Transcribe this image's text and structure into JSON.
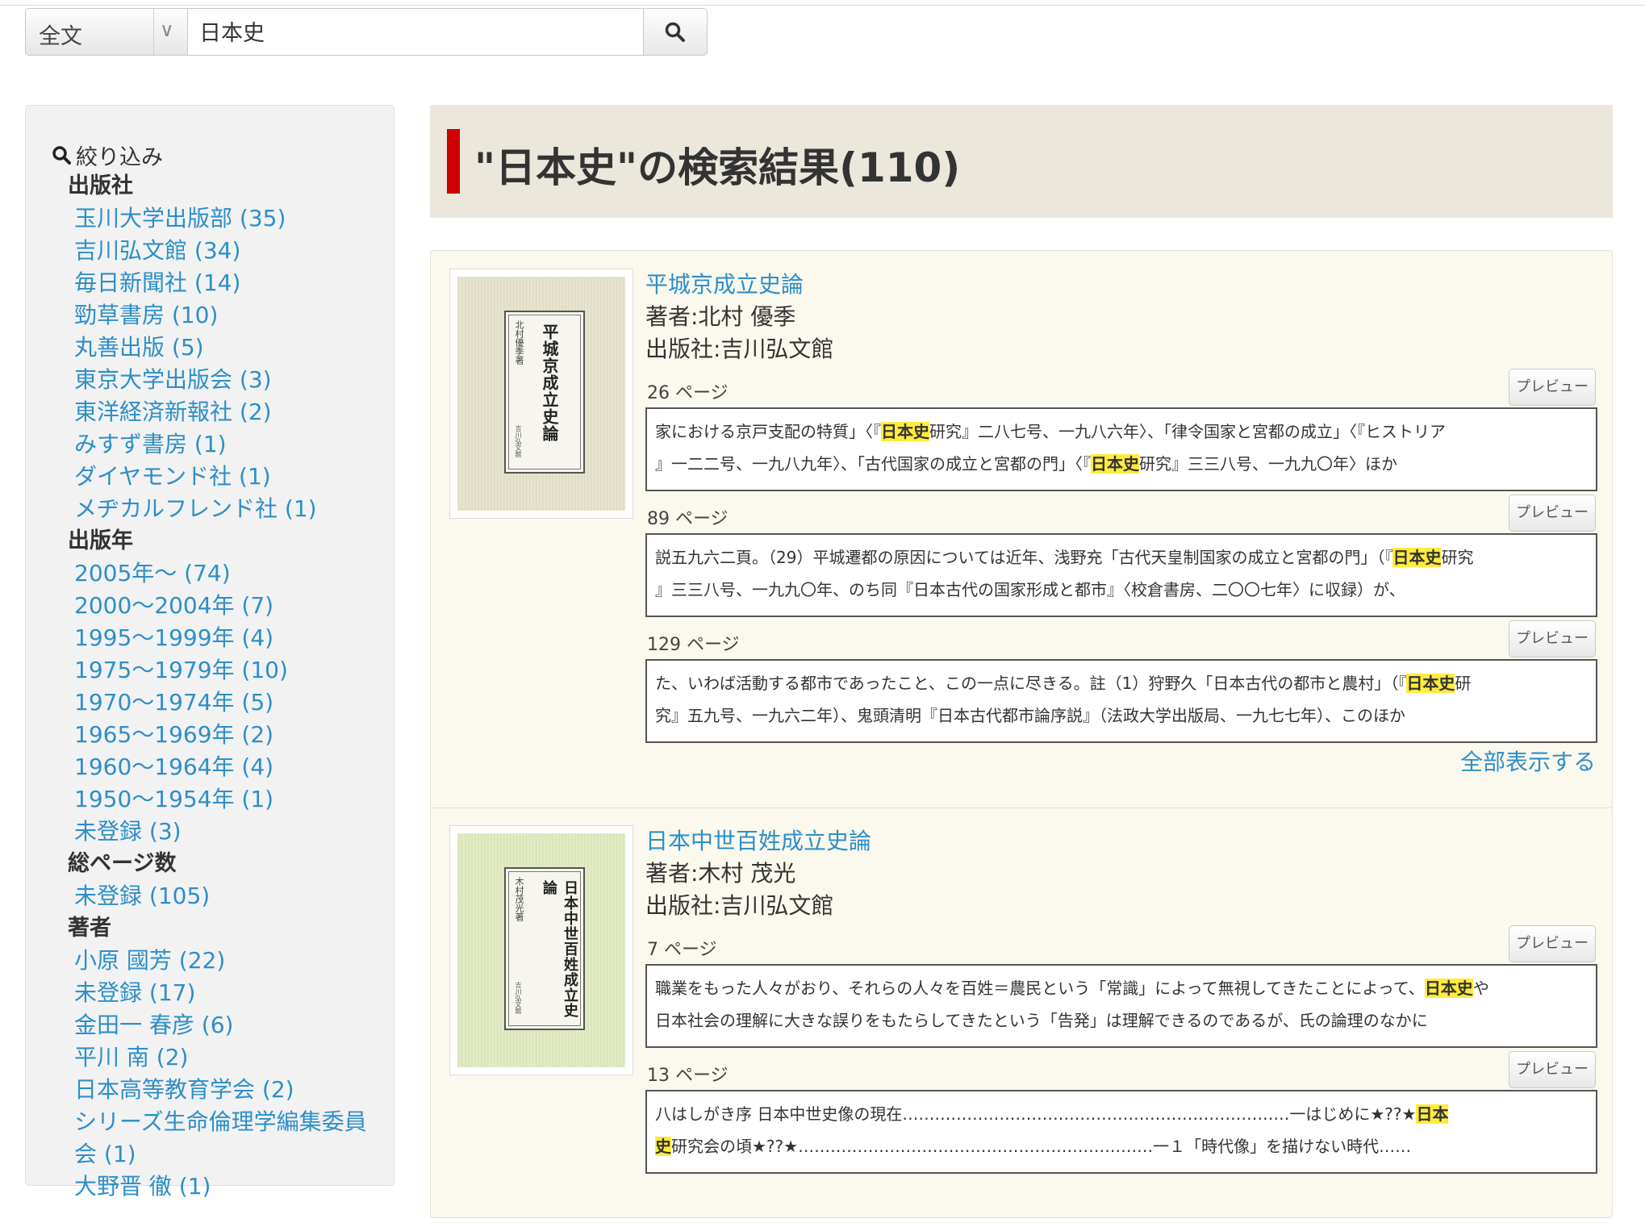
{
  "search": {
    "scope": "全文",
    "query": "日本史"
  },
  "sidebar": {
    "filter_title": "絞り込み",
    "groups": [
      {
        "heading": "出版社",
        "items": [
          "玉川大学出版部 (35)",
          "吉川弘文館 (34)",
          "毎日新聞社 (14)",
          "勁草書房 (10)",
          "丸善出版 (5)",
          "東京大学出版会 (3)",
          "東洋経済新報社 (2)",
          "みすず書房 (1)",
          "ダイヤモンド社 (1)",
          "メヂカルフレンド社 (1)"
        ]
      },
      {
        "heading": "出版年",
        "items": [
          "2005年〜 (74)",
          "2000〜2004年 (7)",
          "1995〜1999年 (4)",
          "1975〜1979年 (10)",
          "1970〜1974年 (5)",
          "1965〜1969年 (2)",
          "1960〜1964年 (4)",
          "1950〜1954年 (1)",
          "未登録 (3)"
        ]
      },
      {
        "heading": "総ページ数",
        "items": [
          "未登録 (105)"
        ]
      },
      {
        "heading": "著者",
        "items": [
          "小原 國芳 (22)",
          "未登録 (17)",
          "金田一 春彦 (6)",
          "平川 南 (2)",
          "日本高等教育学会 (2)",
          "シリーズ生命倫理学編集委員会 (1)",
          "大野晋 徹 (1)"
        ]
      }
    ]
  },
  "header": {
    "title": "\"日本史\"の検索結果(110)"
  },
  "results": [
    {
      "title": "平城京成立史論",
      "author": "著者:北村 優季",
      "publisher": "出版社:吉川弘文館",
      "cover_title": "平城京成立史論",
      "cover_author": "北村優季著",
      "cover_publisher": "吉川弘文館",
      "hits": [
        {
          "page": "26 ページ",
          "preview": "プレビュー",
          "line1": [
            "家における京戸支配の特質」〈『",
            "日本史",
            "研究』二八七号、一九八六年〉、「律令国家と宮都の成立」〈『ヒストリア"
          ],
          "line2": [
            "』一二二号、一九八九年〉、「古代国家の成立と宮都の門」〈『",
            "日本史",
            "研究』三三八号、一九九〇年〉ほか"
          ]
        },
        {
          "page": "89 ページ",
          "preview": "プレビュー",
          "line1": [
            "説五九六二頁。（29）平城遷都の原因については近年、浅野充「古代天皇制国家の成立と宮都の門」（『",
            "日本史",
            "研究"
          ],
          "line2": [
            "』三三八号、一九九〇年、のち同『日本古代の国家形成と都市』〈校倉書房、二〇〇七年〉に収録）が、",
            "",
            ""
          ]
        },
        {
          "page": "129 ページ",
          "preview": "プレビュー",
          "line1": [
            "た、いわば活動する都市であったこと、この一点に尽きる。註（1）狩野久「日本古代の都市と農村」（『",
            "日本史",
            "研"
          ],
          "line2": [
            "究』五九号、一九六二年）、鬼頭清明『日本古代都市論序説』（法政大学出版局、一九七七年）、このほか",
            "",
            ""
          ]
        }
      ],
      "show_all": "全部表示する"
    },
    {
      "title": "日本中世百姓成立史論",
      "author": "著者:木村 茂光",
      "publisher": "出版社:吉川弘文館",
      "cover_title": "日本中世百姓成立史論",
      "cover_author": "木村茂光著",
      "cover_publisher": "吉川弘文館",
      "hits": [
        {
          "page": "7 ページ",
          "preview": "プレビュー",
          "line1": [
            "職業をもった人々がおり、それらの人々を百姓＝農民という「常識」によって無視してきたことによって、",
            "日本史",
            "や"
          ],
          "line2": [
            "日本社会の理解に大きな誤りをもたらしてきたという「告発」は理解できるのであるが、氏の論理のなかに",
            "",
            ""
          ]
        },
        {
          "page": "13 ページ",
          "preview": "プレビュー",
          "line1": [
            "八はしがき序 日本中世史像の現在………………………………………………………………一はじめに★??★",
            "日本",
            ""
          ],
          "line2": [
            "",
            "史",
            "研究会の頃★??★…………………………………………………………一１「時代像」を描けない時代……"
          ]
        }
      ]
    }
  ]
}
